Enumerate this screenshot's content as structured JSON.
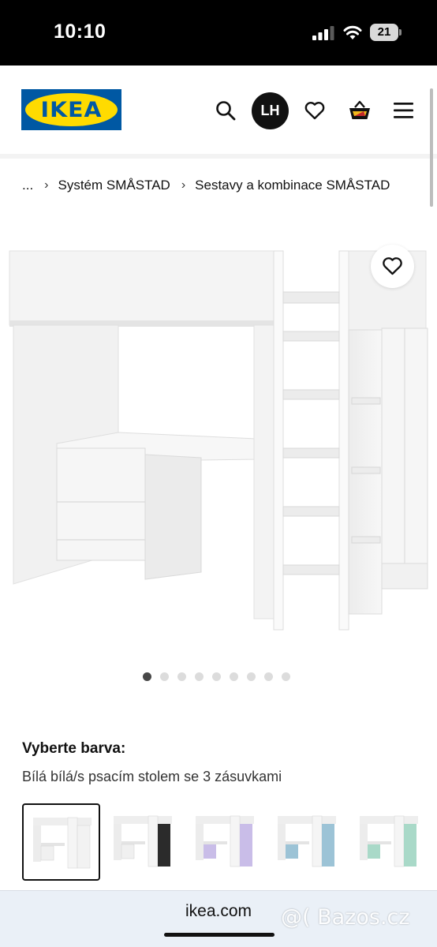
{
  "status_bar": {
    "time": "10:10",
    "battery": "21",
    "icons": [
      "signal-icon",
      "wifi-icon",
      "battery-icon"
    ]
  },
  "header": {
    "logo_text": "IKEA",
    "avatar_initials": "LH",
    "icons": [
      "search-icon",
      "heart-icon",
      "basket-icon",
      "menu-icon"
    ],
    "colors": {
      "brand_blue": "#0058a3",
      "brand_yellow": "#ffdb00"
    }
  },
  "breadcrumb": {
    "items": [
      "...",
      "Systém SMÅSTAD",
      "Sestavy a kombinace SMÅSTAD"
    ]
  },
  "gallery": {
    "dot_count": 9,
    "active_index": 0,
    "favorite_icon": "heart-icon"
  },
  "color_selection": {
    "heading": "Vyberte barva:",
    "value": "Bílá bílá/s psacím stolem se 3 zásuvkami",
    "swatches": [
      {
        "accent": "#ffffff",
        "selected": true
      },
      {
        "accent": "#2b2b2b",
        "selected": false
      },
      {
        "accent": "#c9bde8",
        "selected": false
      },
      {
        "accent": "#9cc3d6",
        "selected": false
      },
      {
        "accent": "#a9d9c8",
        "selected": false
      }
    ]
  },
  "browser": {
    "url": "ikea.com"
  },
  "watermark": "@( Bazos.cz"
}
